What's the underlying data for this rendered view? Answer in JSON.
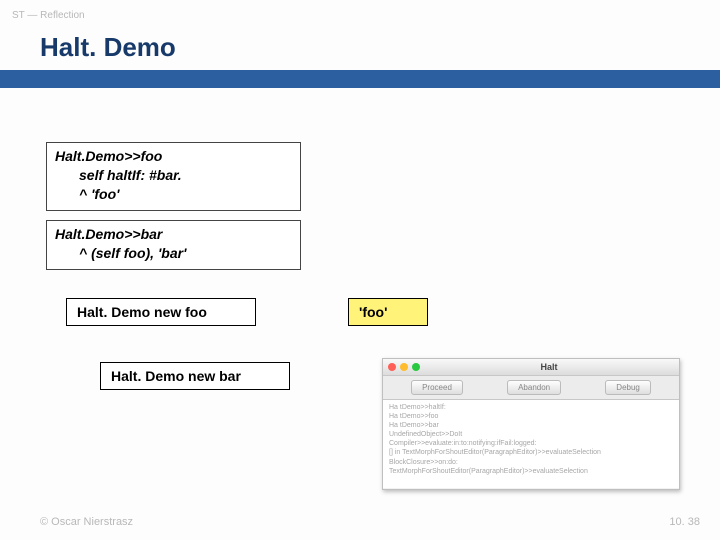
{
  "crumb": "ST — Reflection",
  "title": "Halt. Demo",
  "code_foo": {
    "l1": "Halt.Demo>>foo",
    "l2": "self haltIf: #bar.",
    "l3": "^ 'foo'"
  },
  "code_bar": {
    "l1": "Halt.Demo>>bar",
    "l2": "^ (self foo), 'bar'"
  },
  "expr_newfoo": "Halt. Demo new foo",
  "expr_newbar": "Halt. Demo new bar",
  "result_foo": "'foo'",
  "debugger": {
    "wtitle": "Halt",
    "btn_proceed": "Proceed",
    "btn_abandon": "Abandon",
    "btn_debug": "Debug",
    "stack": [
      "Ha tDemo>>haltIf:",
      "Ha tDemo>>foo",
      "Ha tDemo>>bar",
      "UndefinedObject>>DoIt",
      "Compiler>>evaluate:in:to:notifying:ifFail:logged:",
      "[] in TextMorphForShoutEditor(ParagraphEditor)>>evaluateSelection",
      "BlockClosure>>on:do:",
      "TextMorphForShoutEditor(ParagraphEditor)>>evaluateSelection"
    ]
  },
  "footer_left": "© Oscar Nierstrasz",
  "footer_right": "10. 38"
}
